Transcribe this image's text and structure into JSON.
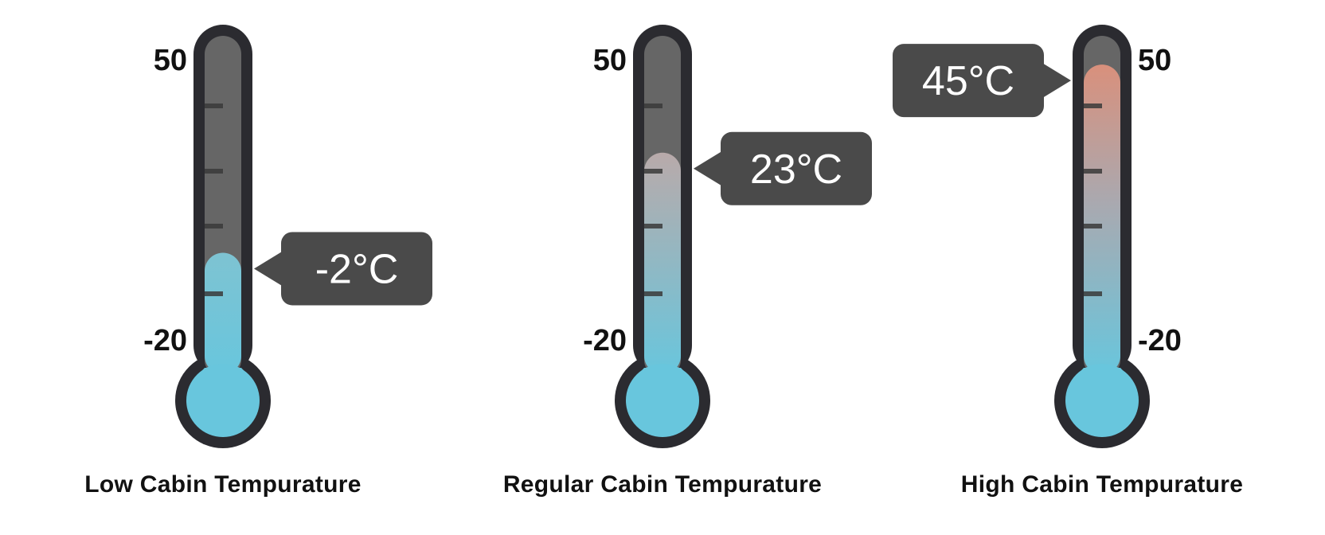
{
  "colors": {
    "frame": "#2b2b30",
    "tube_empty": "#666666",
    "tick": "#3a3a3a",
    "cold": "#68c6dd",
    "hot": "#d9907c",
    "callout_bg": "#4a4a4a",
    "callout_text": "#ffffff"
  },
  "scale": {
    "max_label": "50",
    "min_label": "-20",
    "max": 50,
    "min": -20
  },
  "thermometers": [
    {
      "reading": -2,
      "reading_label": "-2°C",
      "caption": "Low Cabin Tempurature",
      "label_side": "left",
      "callout_side": "right"
    },
    {
      "reading": 23,
      "reading_label": "23°C",
      "caption": "Regular Cabin Tempurature",
      "label_side": "left",
      "callout_side": "right"
    },
    {
      "reading": 45,
      "reading_label": "45°C",
      "caption": "High Cabin Tempurature",
      "label_side": "right",
      "callout_side": "left"
    }
  ]
}
